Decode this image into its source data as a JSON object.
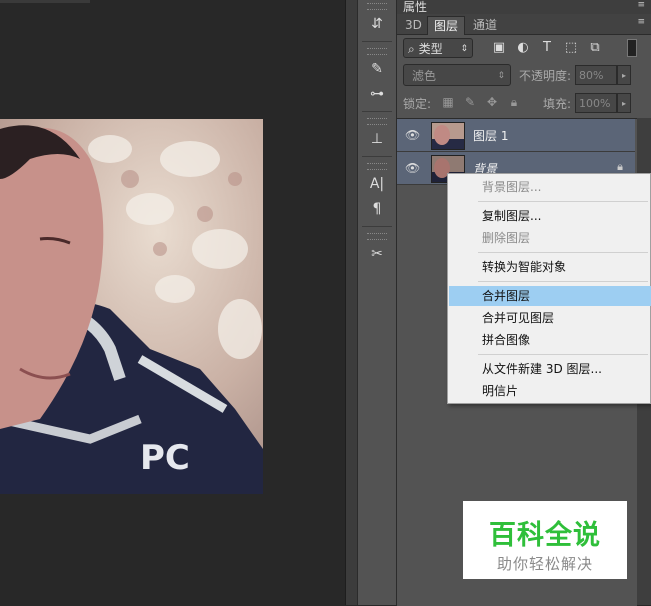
{
  "panel": {
    "collapsed_title": "属性",
    "tabs": [
      {
        "label": "3D"
      },
      {
        "label": "图层"
      },
      {
        "label": "通道"
      }
    ],
    "kind_filter": "类型",
    "blend_mode": "滤色",
    "opacity_label": "不透明度:",
    "opacity_value": "80%",
    "lock_label": "锁定:",
    "fill_label": "填充:",
    "fill_value": "100%"
  },
  "layers": [
    {
      "name": "图层 1"
    },
    {
      "name": "背景"
    }
  ],
  "context_menu": {
    "items": [
      {
        "label": "背景图层...",
        "disabled": true
      },
      {
        "label": "复制图层...",
        "disabled": false
      },
      {
        "label": "删除图层",
        "disabled": true
      },
      {
        "label": "转换为智能对象",
        "disabled": false
      },
      {
        "label": "合并图层",
        "disabled": false,
        "highlighted": true
      },
      {
        "label": "合并可见图层",
        "disabled": false
      },
      {
        "label": "拼合图像",
        "disabled": false
      },
      {
        "label": "从文件新建 3D 图层...",
        "disabled": false
      },
      {
        "label": "明信片",
        "disabled": false
      }
    ]
  },
  "watermark": {
    "title": "百科全说",
    "subtitle": "助你轻松解决"
  },
  "colors": {
    "selected_layer": "#5b6577",
    "menu_highlight": "#9dcef2",
    "watermark_green": "#2fbf3a"
  }
}
